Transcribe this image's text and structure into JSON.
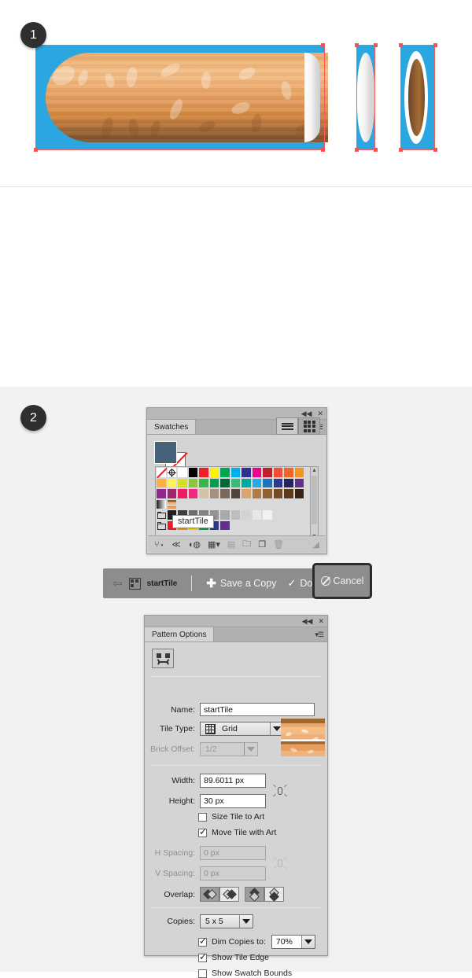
{
  "steps": [
    {
      "number": "1"
    },
    {
      "number": "2"
    }
  ],
  "swatches_panel": {
    "tab_label": "Swatches",
    "collapse_icon": "collapse-double-arrow-icon",
    "close_icon": "close-icon",
    "menu_icon": "panel-menu-icon",
    "fill_color": "#46627a",
    "stroke_color": "none",
    "view_list_icon": "list-view-icon",
    "view_grid_icon": "grid-view-icon",
    "tooltip_text": "startTile",
    "footer_icons": [
      "swatch-libraries-icon",
      "show-swatch-kinds-icon",
      "color-group-icon",
      "swatch-options-icon",
      "new-color-group-icon",
      "new-swatch-icon",
      "delete-swatch-icon",
      "resize-grip-icon"
    ],
    "swatch_rows": [
      [
        "none",
        "registration",
        "#ffffff",
        "#000000",
        "#ed2024",
        "#fff200",
        "#00a651",
        "#00aeef",
        "#2e3192",
        "#ec008c",
        "#be1e2d",
        "#f04e37",
        "#f26522",
        "#f7941e"
      ],
      [
        "#fbb040",
        "#fff457",
        "#d7df23",
        "#8dc63f",
        "#39b54a",
        "#00a14b",
        "#006838",
        "#3cb878",
        "#00a99d",
        "#27aae1",
        "#1c75bc",
        "#2b3990",
        "#262262",
        "#662d91"
      ],
      [
        "#92278f",
        "#a3236d",
        "#ec1c5e",
        "#ee2a7b",
        "#d3c2a6",
        "#a68f7b",
        "#7a6a59",
        "#54433a",
        "#d9a470",
        "#b07b45",
        "#91622f",
        "#754c24",
        "#5c3a1a",
        "#3a2415"
      ],
      [
        "gradient-black-white",
        "pattern-startTile"
      ],
      [
        "folder",
        "#231f20",
        "#404040",
        "#6d6e71",
        "#808285",
        "#939598",
        "#a7a9ac",
        "#bcbec0",
        "#d1d3d4",
        "#e6e7e8",
        "#f1f2f2"
      ],
      [
        "folder",
        "#ed1c24",
        "#f7941e",
        "#ffd400",
        "#00a651",
        "#2b3990",
        "#92278f"
      ]
    ]
  },
  "pattern_toolbar": {
    "back_icon": "back-arrow-icon",
    "tile_icon": "pattern-tile-icon",
    "pattern_name": "startTile",
    "save_copy_label": "Save a Copy",
    "save_copy_icon": "plus-icon",
    "done_label": "Done",
    "done_icon": "check-icon",
    "cancel_label": "Cancel",
    "cancel_icon": "no-entry-icon",
    "cancel_highlighted": true
  },
  "pattern_options": {
    "tab_label": "Pattern Options",
    "collapse_icon": "collapse-double-arrow-icon",
    "close_icon": "close-icon",
    "menu_icon": "panel-menu-icon",
    "tile_tool_icon": "pattern-tile-tool-icon",
    "name_label": "Name:",
    "name_value": "startTile",
    "tile_type_label": "Tile Type:",
    "tile_type_value": "Grid",
    "tile_type_icon": "grid-icon",
    "brick_offset_label": "Brick Offset:",
    "brick_offset_value": "1/2",
    "brick_offset_disabled": true,
    "width_label": "Width:",
    "width_value": "89.6011 px",
    "height_label": "Height:",
    "height_value": "30 px",
    "link_icon": "link-dimensions-icon",
    "size_tile_to_art_label": "Size Tile to Art",
    "size_tile_to_art_checked": false,
    "move_tile_with_art_label": "Move Tile with Art",
    "move_tile_with_art_checked": true,
    "h_spacing_label": "H Spacing:",
    "h_spacing_value": "0 px",
    "h_spacing_disabled": true,
    "v_spacing_label": "V Spacing:",
    "v_spacing_value": "0 px",
    "v_spacing_disabled": true,
    "spacing_link_icon": "link-spacing-icon",
    "overlap_label": "Overlap:",
    "overlap_buttons": [
      {
        "name": "overlap-left-in-front-icon",
        "selected": true
      },
      {
        "name": "overlap-right-in-front-icon",
        "selected": false
      },
      {
        "name": "overlap-top-in-front-icon",
        "selected": true
      },
      {
        "name": "overlap-bottom-in-front-icon",
        "selected": false
      }
    ],
    "copies_label": "Copies:",
    "copies_value": "5 x 5",
    "dim_copies_label": "Dim Copies to:",
    "dim_copies_checked": true,
    "dim_copies_value": "70%",
    "show_tile_edge_label": "Show Tile Edge",
    "show_tile_edge_checked": true,
    "show_swatch_bounds_label": "Show Swatch Bounds",
    "show_swatch_bounds_checked": false
  },
  "colors": {
    "selection_red": "#ff4d4d",
    "artboard_blue": "#2ba6e0",
    "stage_bg": "#f2f2f2",
    "panel_bg": "#d4d4d4",
    "badge_bg": "#2f2f2f"
  }
}
